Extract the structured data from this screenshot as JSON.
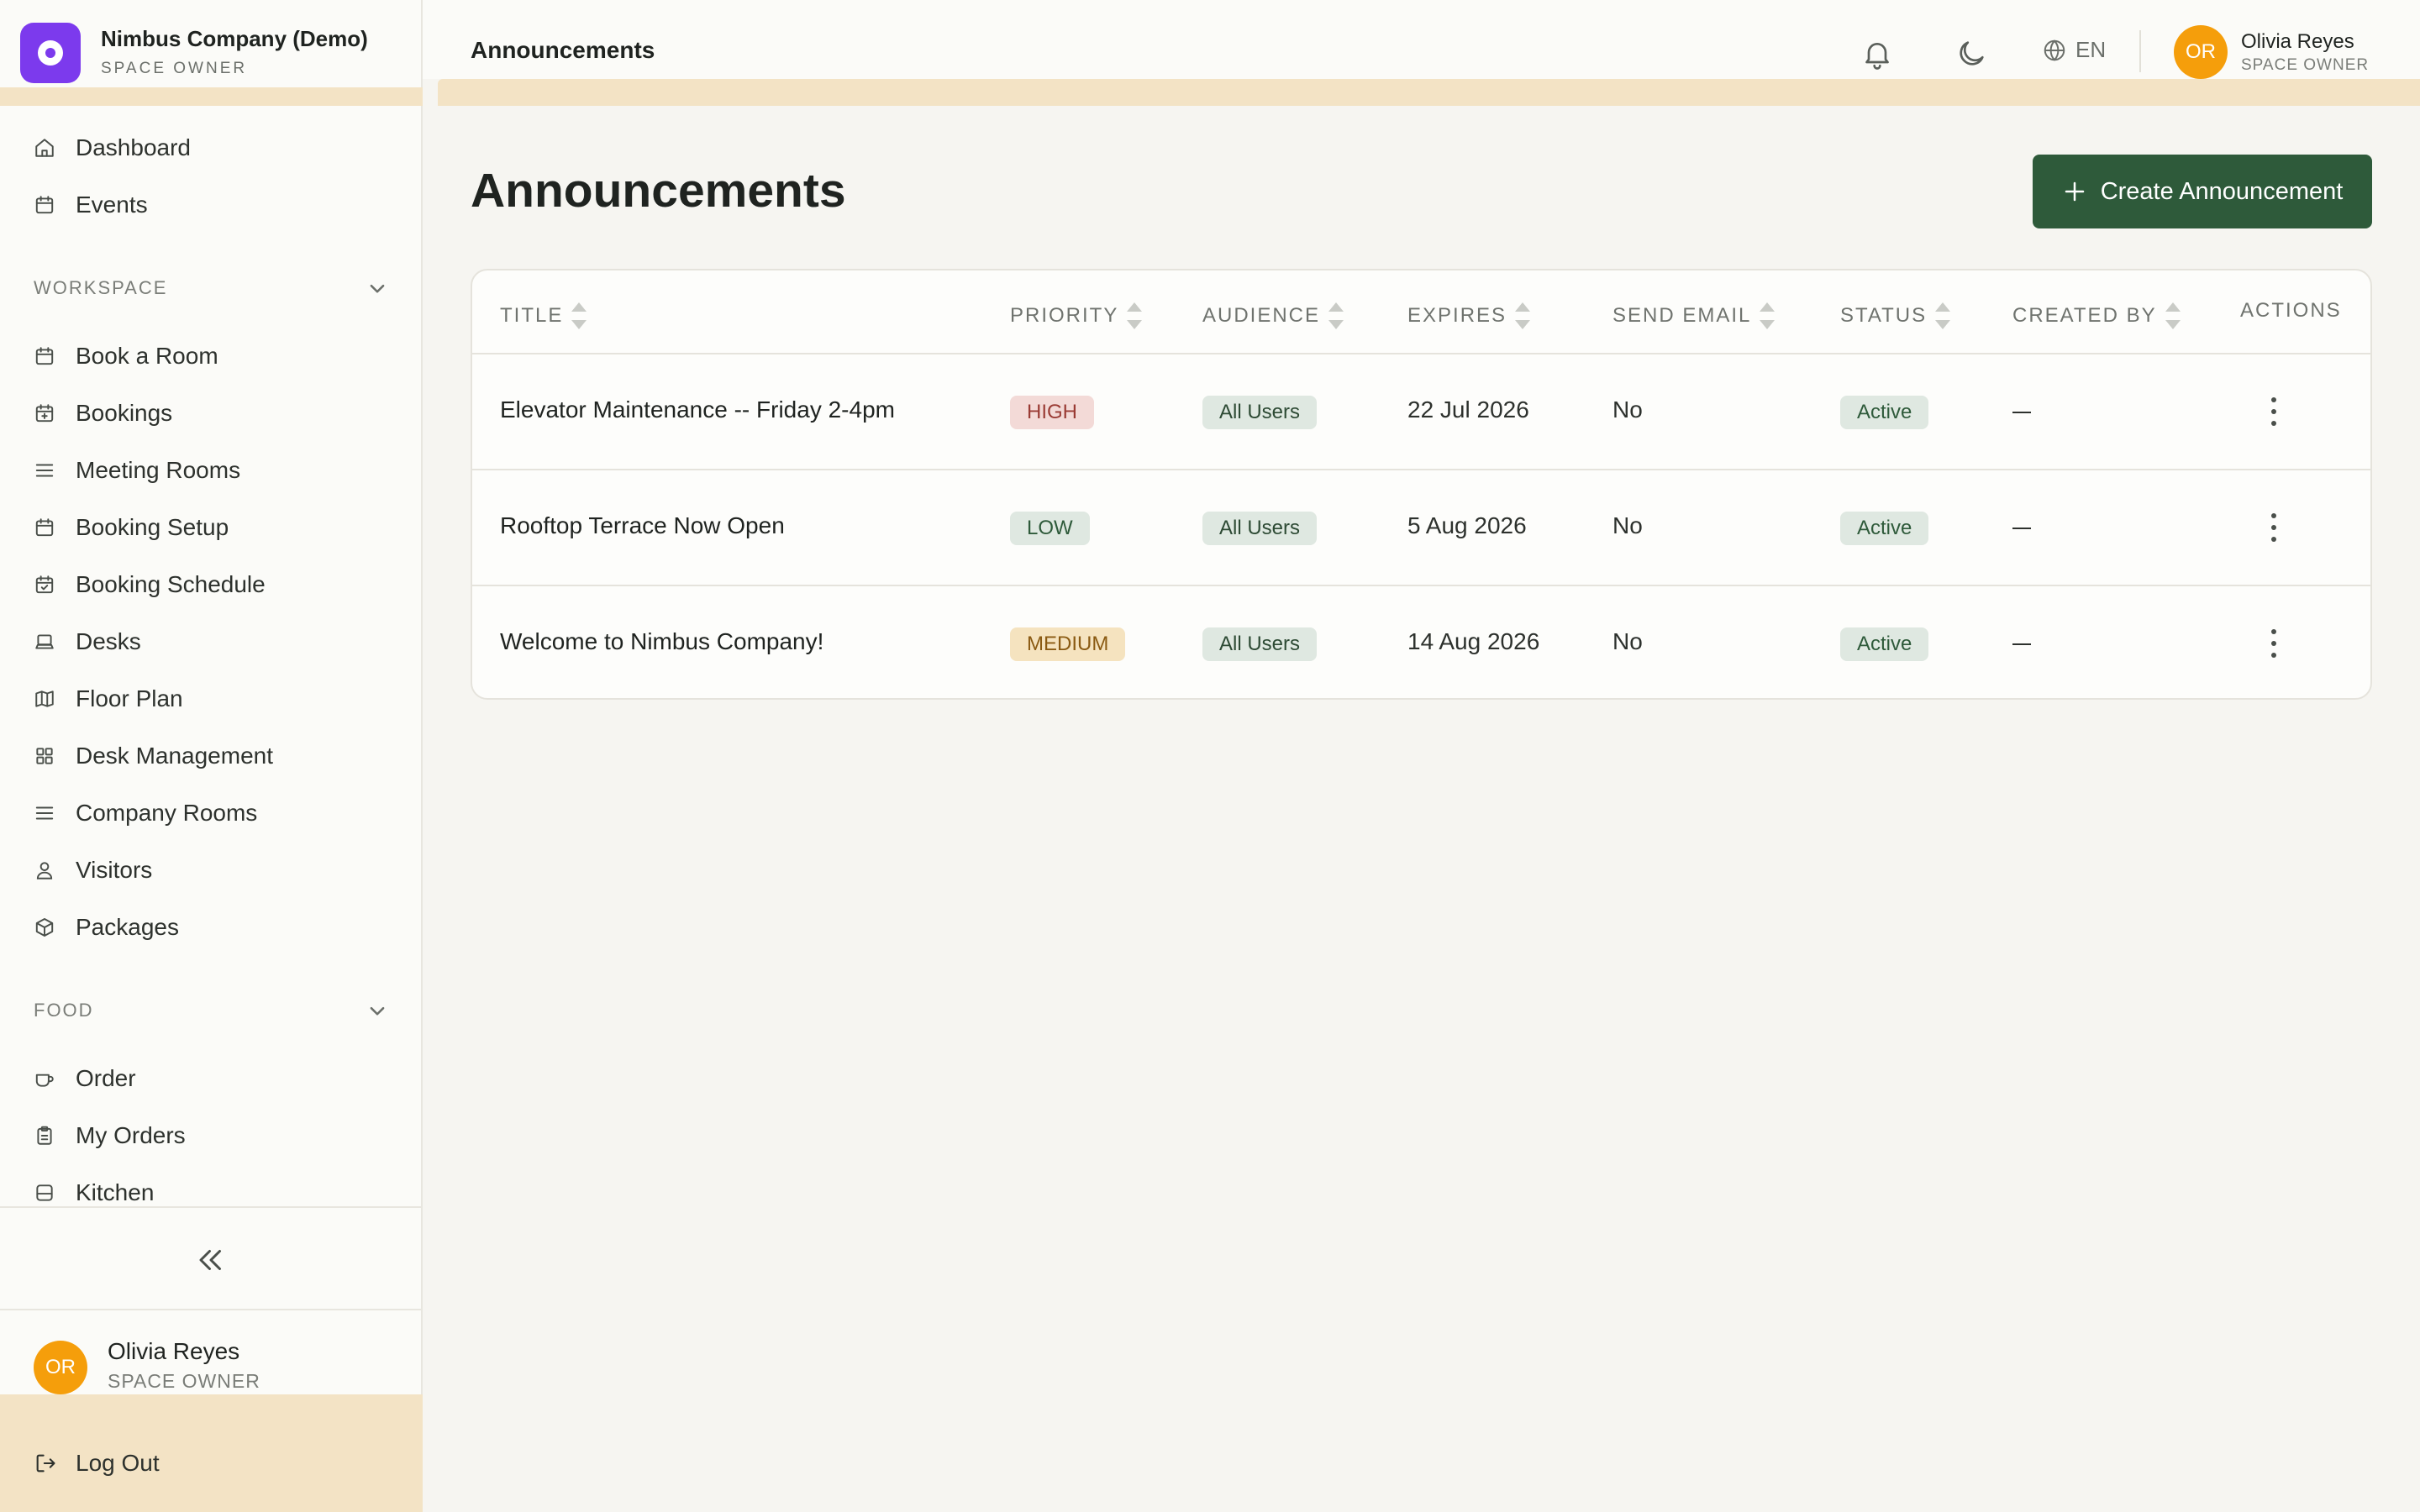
{
  "brand": {
    "name": "Nimbus Company (Demo)",
    "role": "SPACE OWNER"
  },
  "sidebar": {
    "top_items": [
      {
        "label": "Dashboard",
        "icon": "home-icon"
      },
      {
        "label": "Events",
        "icon": "calendar-icon"
      }
    ],
    "sections": [
      {
        "label": "WORKSPACE",
        "items": [
          {
            "label": "Book a Room",
            "icon": "calendar-icon"
          },
          {
            "label": "Bookings",
            "icon": "calendar-plus-icon"
          },
          {
            "label": "Meeting Rooms",
            "icon": "list-icon"
          },
          {
            "label": "Booking Setup",
            "icon": "calendar-icon"
          },
          {
            "label": "Booking Schedule",
            "icon": "calendar-check-icon"
          },
          {
            "label": "Desks",
            "icon": "laptop-icon"
          },
          {
            "label": "Floor Plan",
            "icon": "map-icon"
          },
          {
            "label": "Desk Management",
            "icon": "grid-icon"
          },
          {
            "label": "Company Rooms",
            "icon": "list-icon"
          },
          {
            "label": "Visitors",
            "icon": "user-icon"
          },
          {
            "label": "Packages",
            "icon": "package-icon"
          }
        ]
      },
      {
        "label": "FOOD",
        "items": [
          {
            "label": "Order",
            "icon": "cup-icon"
          },
          {
            "label": "My Orders",
            "icon": "clipboard-icon"
          },
          {
            "label": "Kitchen",
            "icon": "kitchen-icon"
          }
        ]
      }
    ],
    "user": {
      "initials": "OR",
      "name": "Olivia Reyes",
      "role": "SPACE OWNER"
    },
    "logout_label": "Log Out"
  },
  "topbar": {
    "title": "Announcements",
    "language": "EN",
    "user": {
      "initials": "OR",
      "name": "Olivia Reyes",
      "role": "SPACE OWNER"
    }
  },
  "main": {
    "title": "Announcements",
    "create_label": "Create Announcement",
    "columns": [
      "TITLE",
      "PRIORITY",
      "AUDIENCE",
      "EXPIRES",
      "SEND EMAIL",
      "STATUS",
      "CREATED BY",
      "ACTIONS"
    ],
    "rows": [
      {
        "title": "Elevator Maintenance -- Friday 2-4pm",
        "priority": "HIGH",
        "audience": "All Users",
        "expires": "22 Jul 2026",
        "send_email": "No",
        "status": "Active"
      },
      {
        "title": "Rooftop Terrace Now Open",
        "priority": "LOW",
        "audience": "All Users",
        "expires": "5 Aug 2026",
        "send_email": "No",
        "status": "Active"
      },
      {
        "title": "Welcome to Nimbus Company!",
        "priority": "MEDIUM",
        "audience": "All Users",
        "expires": "14 Aug 2026",
        "send_email": "No",
        "status": "Active"
      }
    ]
  },
  "colors": {
    "accent": "#2e5a3a",
    "brand": "#7c3aed",
    "avatar": "#f59e0b",
    "highlight_strip": "#f3e3c5"
  }
}
